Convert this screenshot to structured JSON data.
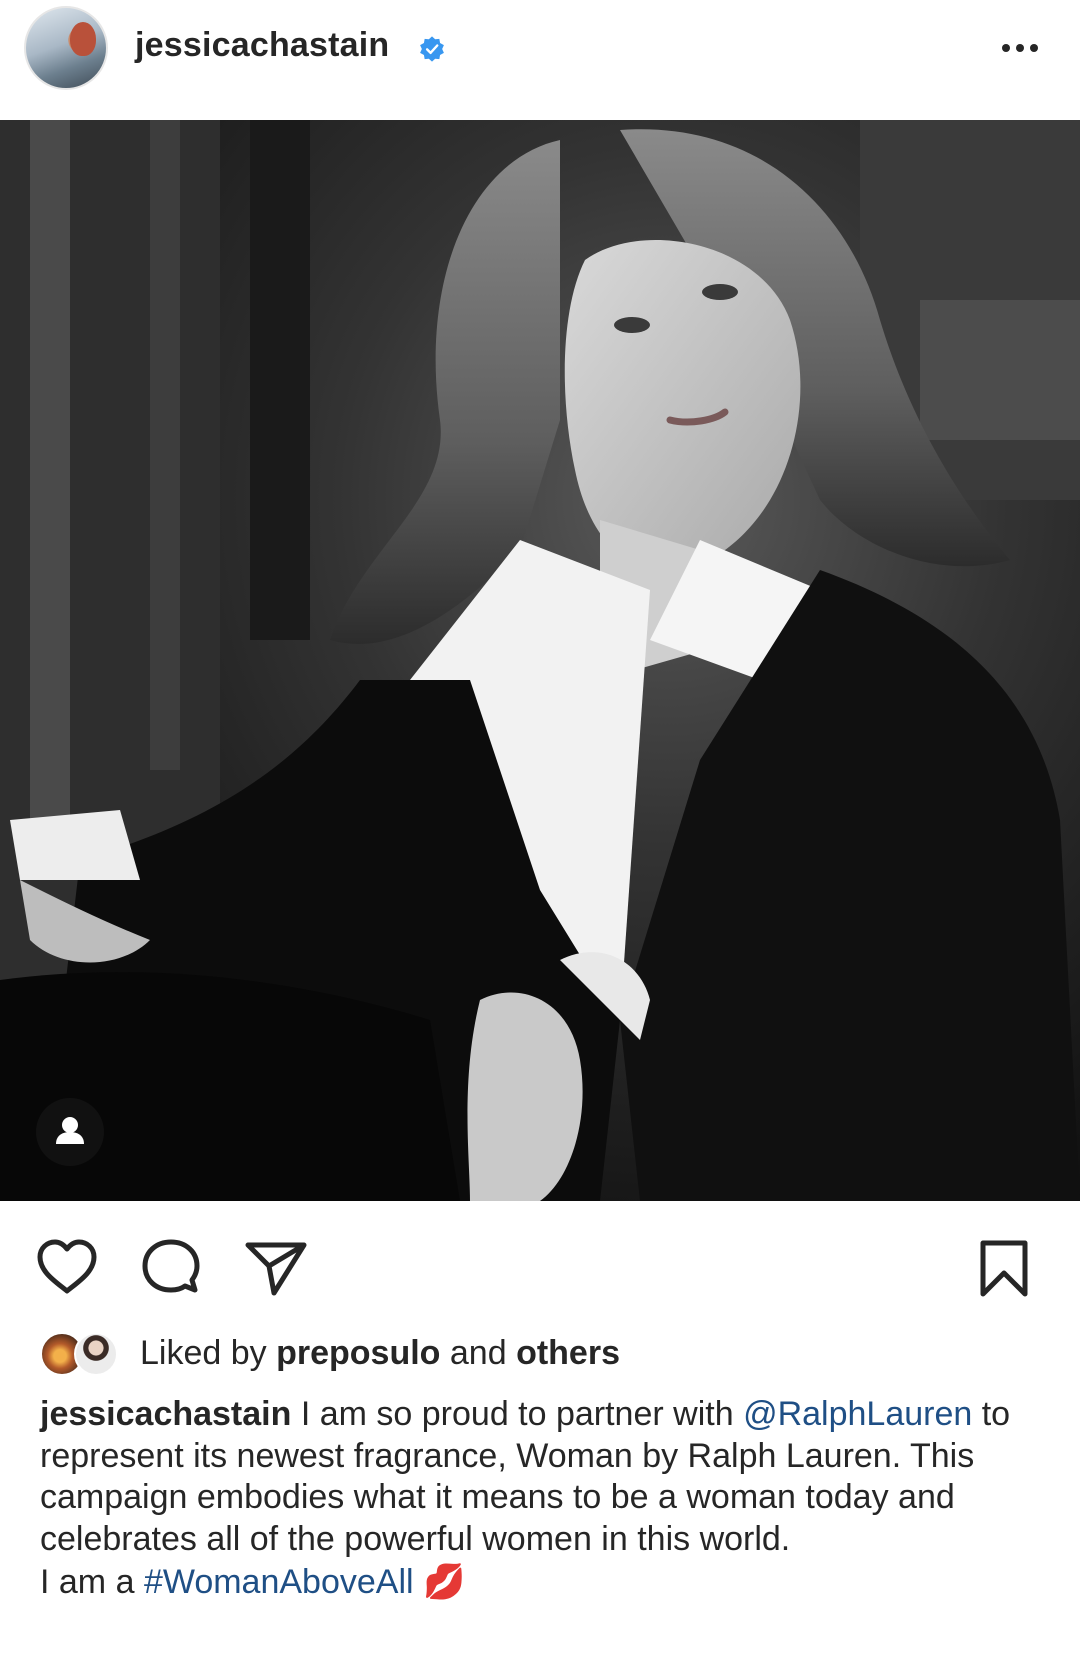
{
  "header": {
    "username": "jessicachastain",
    "verified_icon": "verified-badge-icon",
    "more_icon": "more-options-icon"
  },
  "photo": {
    "tag_icon": "person-tag-icon"
  },
  "actions": {
    "like_icon": "heart-icon",
    "comment_icon": "comment-icon",
    "share_icon": "share-paper-plane-icon",
    "save_icon": "bookmark-icon"
  },
  "likes": {
    "prefix": "Liked by ",
    "user": "preposulo",
    "middle": " and ",
    "others": "others"
  },
  "caption": {
    "username": "jessicachastain",
    "text_before_mention": " I am so proud to partner with ",
    "mention": "@RalphLauren",
    "text_after_mention": " to represent its newest fragrance, Woman by Ralph Lauren. This campaign embodies what it means to be a woman today and celebrates all of the powerful women in this world.",
    "line2_prefix": "I am a ",
    "hashtag": "#WomanAboveAll",
    "emoji": "💋"
  },
  "colors": {
    "text": "#262626",
    "link": "#1f4f85",
    "verified": "#3897f0"
  }
}
